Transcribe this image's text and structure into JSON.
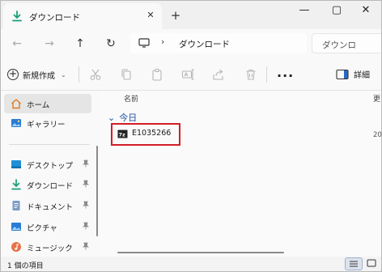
{
  "window": {
    "tab_title": "ダウンロード",
    "tab_close_glyph": "✕",
    "new_tab_glyph": "+",
    "minimize_glyph": "—",
    "maximize_glyph": "▢",
    "close_glyph": "✕"
  },
  "nav": {
    "back_glyph": "←",
    "forward_glyph": "→",
    "up_glyph": "↑",
    "refresh_glyph": "↻",
    "breadcrumb_separator": "›",
    "breadcrumb": "ダウンロード",
    "search_placeholder": "ダウンロ"
  },
  "toolbar": {
    "new_label": "新規作成",
    "new_chevron": "⌄",
    "more_glyph": "...",
    "details_label": "詳細"
  },
  "sidebar": {
    "items": [
      {
        "label": "ホーム",
        "icon": "home-icon"
      },
      {
        "label": "ギャラリー",
        "icon": "gallery-icon"
      },
      {
        "label": "デスクトップ",
        "icon": "desktop-icon"
      },
      {
        "label": "ダウンロード",
        "icon": "download-icon"
      },
      {
        "label": "ドキュメント",
        "icon": "document-icon"
      },
      {
        "label": "ピクチャ",
        "icon": "picture-icon"
      },
      {
        "label": "ミュージック",
        "icon": "music-icon"
      }
    ]
  },
  "files": {
    "column_name": "名前",
    "column_date": "更",
    "group_label": "今日",
    "group_chevron": "⌄",
    "rows": [
      {
        "name": "E1035266",
        "date": "20"
      }
    ]
  },
  "status": {
    "item_count": "1 個の項目"
  },
  "colors": {
    "accent": "#1e4fa0",
    "highlight_border": "#d21e26",
    "download_icon": "#1a9e7a"
  }
}
